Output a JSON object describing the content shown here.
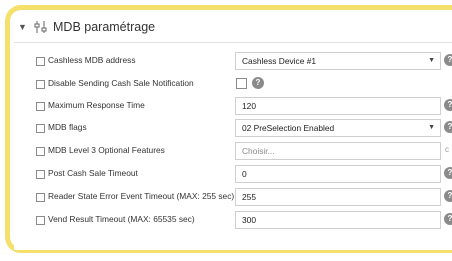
{
  "section": {
    "title": "MDB paramétrage",
    "chevron": "chevron-down-icon",
    "icon": "settings-sliders-icon"
  },
  "fields": [
    {
      "label": "Cashless MDB address",
      "type": "select",
      "value": "Cashless Device #1"
    },
    {
      "label": "Disable Sending Cash Sale Notification",
      "type": "checkbox",
      "value": ""
    },
    {
      "label": "Maximum Response Time",
      "type": "text",
      "value": "120"
    },
    {
      "label": "MDB flags",
      "type": "select",
      "value": "02 PreSelection Enabled"
    },
    {
      "label": "MDB Level 3 Optional Features",
      "type": "multiselect",
      "placeholder": "Choisir..."
    },
    {
      "label": "Post Cash Sale Timeout",
      "type": "text",
      "value": "0"
    },
    {
      "label": "Reader State Error Event Timeout (MAX: 255 sec)",
      "type": "text",
      "value": "255"
    },
    {
      "label": "Vend Result Timeout (MAX: 65535 sec)",
      "type": "text",
      "value": "300"
    }
  ],
  "help_glyph": "?",
  "caret_glyph": "▼",
  "clear_glyph": "c",
  "colors": {
    "frame_accent": "#f4e06a",
    "help_icon": "#8a8a8a"
  }
}
